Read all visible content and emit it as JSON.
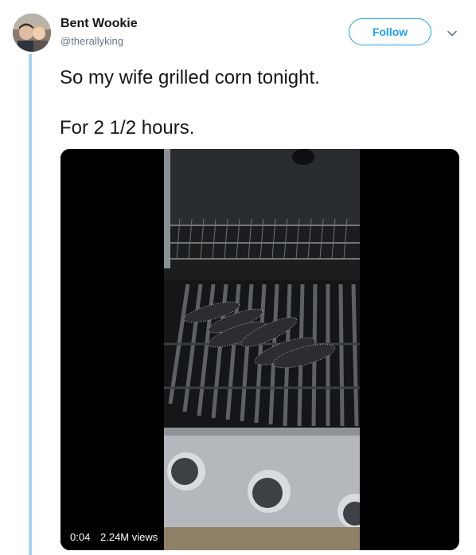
{
  "author": {
    "display_name": "Bent Wookie",
    "handle": "@therallyking"
  },
  "actions": {
    "follow_label": "Follow"
  },
  "tweet": {
    "lines": [
      "So my wife grilled corn tonight.",
      "For 2 1/2 hours."
    ]
  },
  "video": {
    "elapsed": "0:04",
    "views": "2.24M views"
  },
  "colors": {
    "accent": "#1da1f2",
    "thread_line": "#a6d3ef",
    "secondary_text": "#657786"
  },
  "icons": {
    "menu": "chevron-down-icon"
  }
}
